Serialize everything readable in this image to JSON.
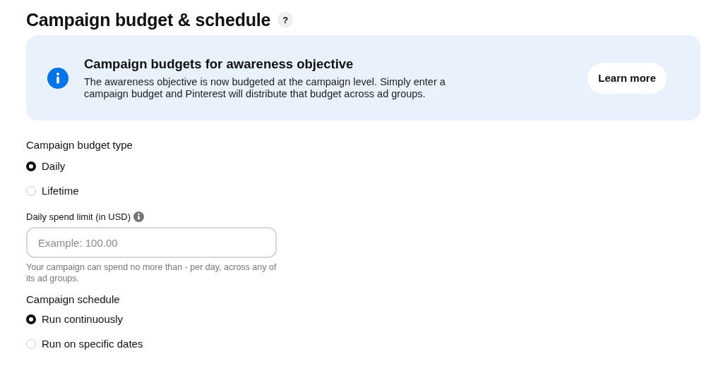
{
  "header": {
    "title": "Campaign budget & schedule",
    "help_icon": "?"
  },
  "banner": {
    "title": "Campaign budgets for awareness objective",
    "body": "The awareness objective is now budgeted at the campaign level. Simply enter a campaign budget and Pinterest will distribute that budget across ad groups.",
    "button": "Learn more"
  },
  "budget_type": {
    "label": "Campaign budget type",
    "options": [
      {
        "label": "Daily",
        "selected": true
      },
      {
        "label": "Lifetime",
        "selected": false
      }
    ]
  },
  "spend_limit": {
    "label": "Daily spend limit (in USD)",
    "placeholder": "Example: 100.00",
    "helper": "Your campaign can spend no more than - per day, across any of its ad groups."
  },
  "schedule": {
    "label": "Campaign schedule",
    "options": [
      {
        "label": "Run continuously",
        "selected": true
      },
      {
        "label": "Run on specific dates",
        "selected": false
      }
    ]
  }
}
